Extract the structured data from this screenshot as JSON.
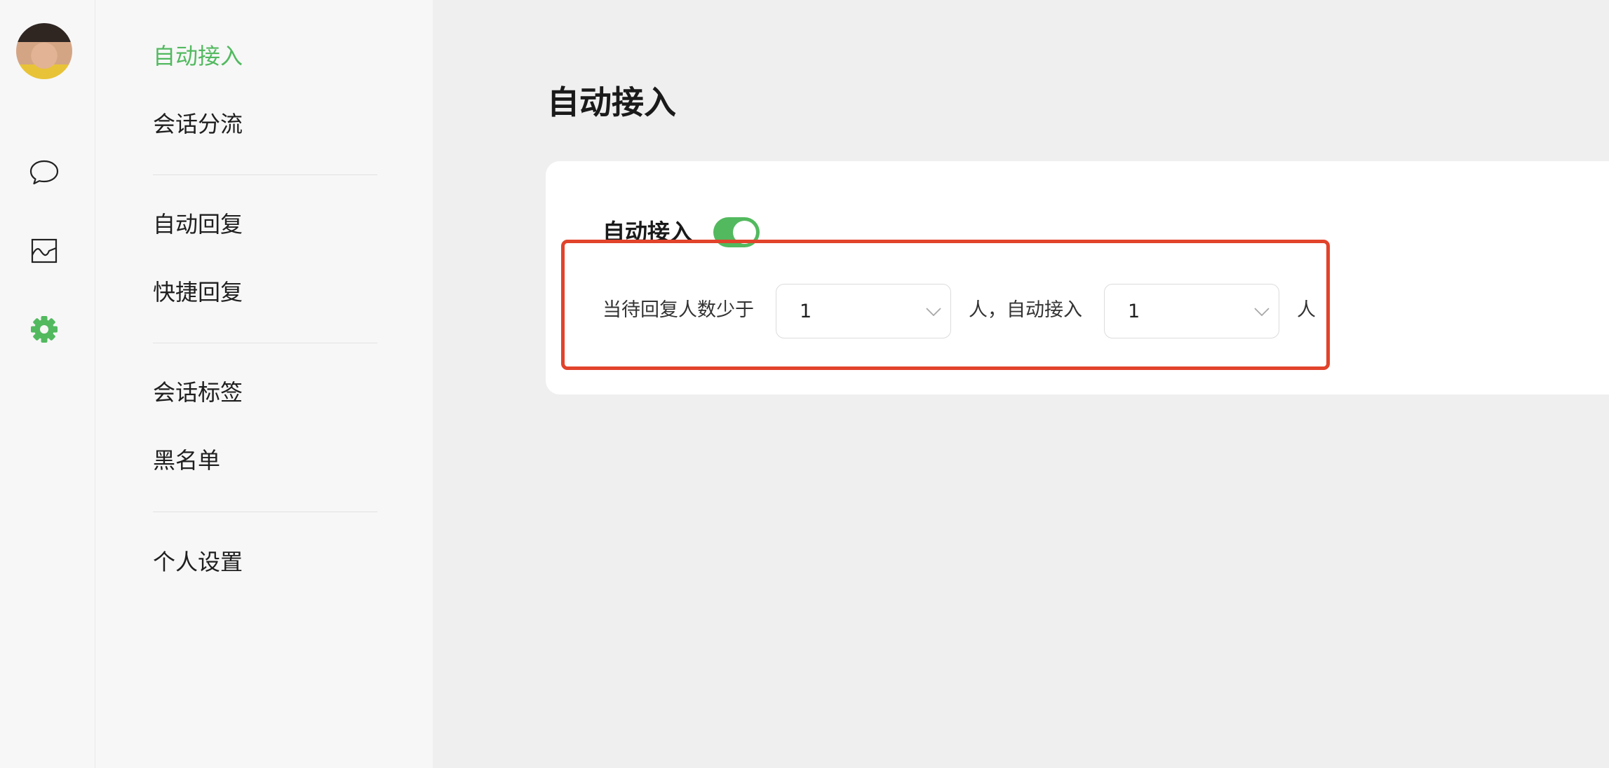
{
  "rail": {
    "icons": {
      "avatar": "avatar",
      "chat": "chat-bubble-icon",
      "stats": "chart-icon",
      "settings": "settings-gear-icon"
    },
    "active": "settings"
  },
  "sidebar": {
    "groups": [
      {
        "items": [
          {
            "label": "自动接入",
            "active": true
          },
          {
            "label": "会话分流",
            "active": false
          }
        ]
      },
      {
        "items": [
          {
            "label": "自动回复",
            "active": false
          },
          {
            "label": "快捷回复",
            "active": false
          }
        ]
      },
      {
        "items": [
          {
            "label": "会话标签",
            "active": false
          },
          {
            "label": "黑名单",
            "active": false
          }
        ]
      },
      {
        "items": [
          {
            "label": "个人设置",
            "active": false
          }
        ]
      }
    ]
  },
  "page": {
    "title": "自动接入"
  },
  "auto_accept": {
    "toggle_label": "自动接入",
    "enabled": true,
    "rule": {
      "prefix": "当待回复人数少于",
      "threshold": "1",
      "middle": "人，自动接入",
      "accept_count": "1",
      "suffix": "人"
    }
  },
  "colors": {
    "accent": "#52b95f",
    "highlight": "#e1432b",
    "text": "#1f1f1f"
  }
}
